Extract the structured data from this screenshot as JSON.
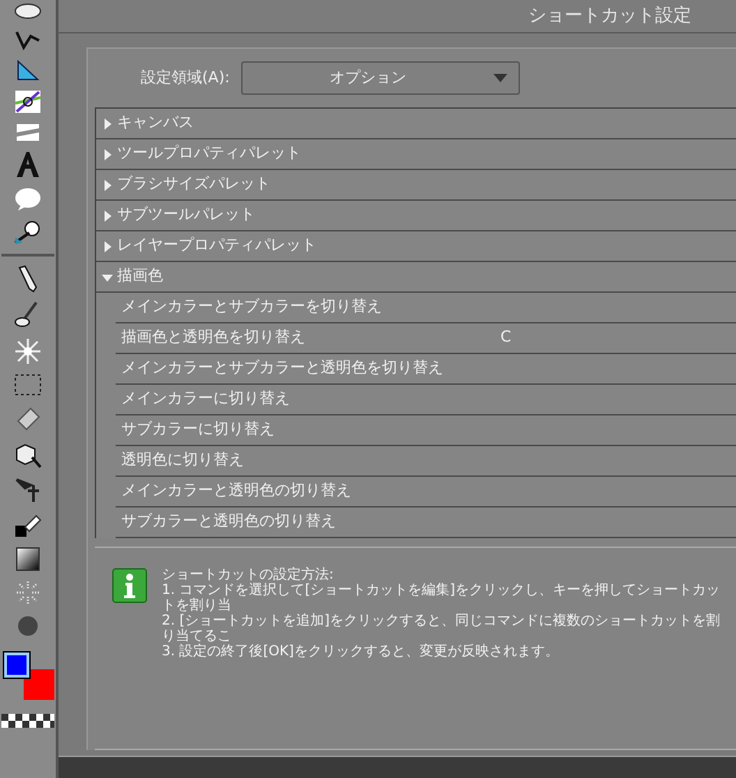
{
  "window": {
    "title": "ショートカット設定"
  },
  "scope": {
    "label": "設定領域(A):",
    "value": "オプション"
  },
  "categories": [
    {
      "label": "キャンバス",
      "expanded": false
    },
    {
      "label": "ツールプロパティパレット",
      "expanded": false
    },
    {
      "label": "ブラシサイズパレット",
      "expanded": false
    },
    {
      "label": "サブツールパレット",
      "expanded": false
    },
    {
      "label": "レイヤープロパティパレット",
      "expanded": false
    },
    {
      "label": "描画色",
      "expanded": true,
      "children": [
        {
          "label": "メインカラーとサブカラーを切り替え"
        },
        {
          "label": "描画色と透明色を切り替え",
          "shortcut": "C"
        },
        {
          "label": "メインカラーとサブカラーと透明色を切り替え"
        },
        {
          "label": "メインカラーに切り替え"
        },
        {
          "label": "サブカラーに切り替え"
        },
        {
          "label": "透明色に切り替え"
        },
        {
          "label": "メインカラーと透明色の切り替え"
        },
        {
          "label": "サブカラーと透明色の切り替え"
        }
      ]
    }
  ],
  "info": {
    "title": "ショートカットの設定方法:",
    "lines": [
      "1. コマンドを選択して[ショートカットを編集]をクリックし、キーを押してショートカットを割り当",
      "2. [ショートカットを追加]をクリックすると、同じコマンドに複数のショートカットを割り当てるこ",
      "3. 設定の終了後[OK]をクリックすると、変更が反映されます。"
    ]
  },
  "swatches": [
    {
      "color": "#0000ff"
    },
    {
      "color": "#ff0000"
    }
  ]
}
